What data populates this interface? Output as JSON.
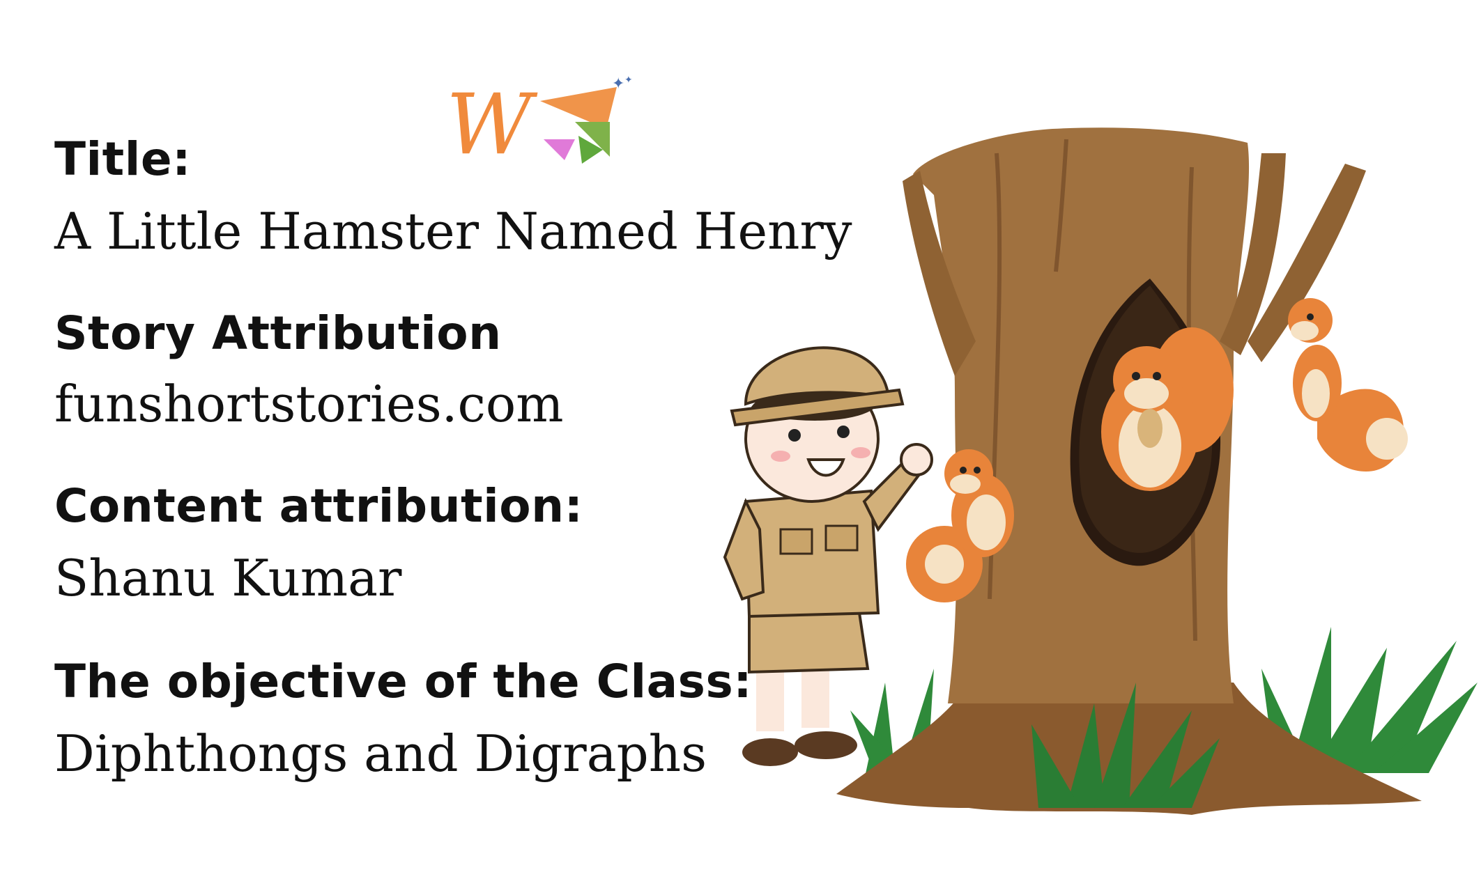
{
  "sections": [
    {
      "heading": "Title:",
      "value": "A Little Hamster Named Henry"
    },
    {
      "heading": "Story Attribution",
      "value": "funshortstories.com"
    },
    {
      "heading": "Content attribution:",
      "value": "Shanu Kumar"
    },
    {
      "heading": "The objective of the Class:",
      "value": "Diphthongs and Digraphs"
    }
  ],
  "logo": {
    "letter": "W",
    "colors": {
      "letter": "#f08a3c",
      "triangle_orange": "#f0944a",
      "triangle_green": "#7fb24a",
      "triangle_pink": "#e07ad8",
      "sparkle": "#4a6fb0"
    }
  },
  "illustration": {
    "icon": "boy-explorer-with-squirrels-in-tree-icon"
  },
  "colors": {
    "text": "#111111",
    "background": "#ffffff",
    "bark": "#a0713f",
    "bark_dark": "#6b4423",
    "grass": "#2f8a3a",
    "squirrel": "#e8843a",
    "khaki": "#d2b07a"
  }
}
